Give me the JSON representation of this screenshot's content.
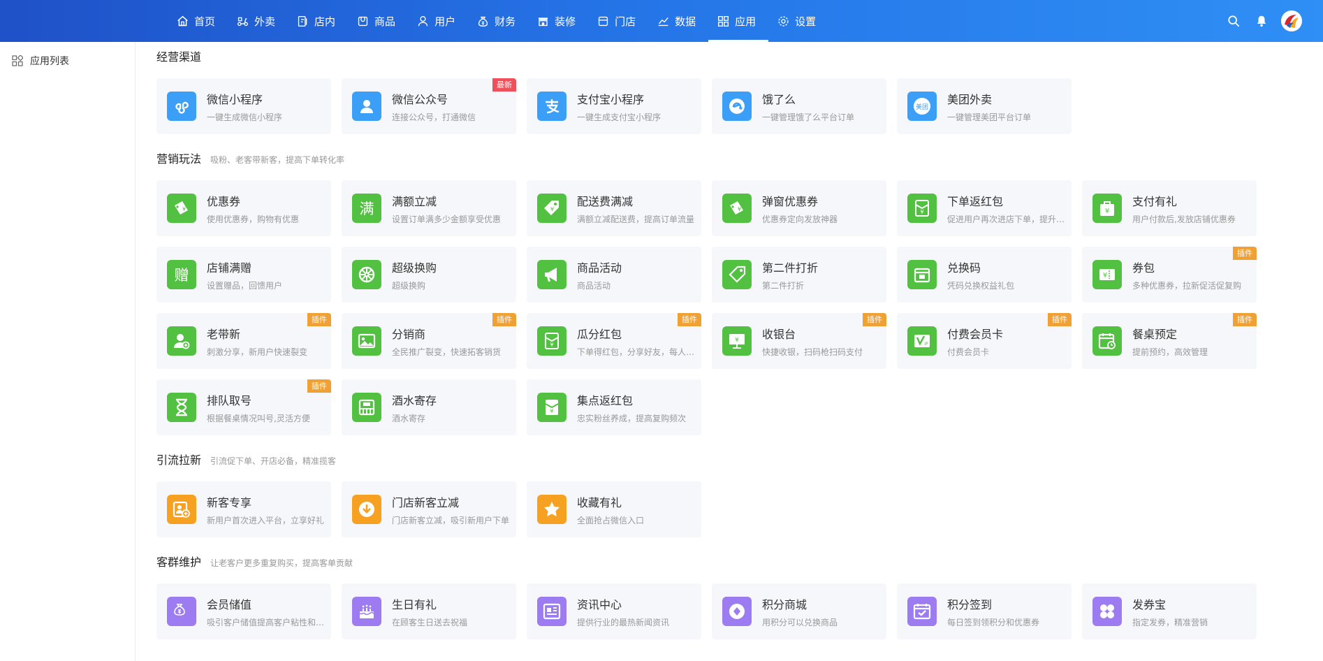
{
  "nav": {
    "items": [
      {
        "label": "首页",
        "icon": "home-icon"
      },
      {
        "label": "外卖",
        "icon": "scooter-icon"
      },
      {
        "label": "店内",
        "icon": "dine-in-icon"
      },
      {
        "label": "商品",
        "icon": "goods-icon"
      },
      {
        "label": "用户",
        "icon": "user-icon"
      },
      {
        "label": "财务",
        "icon": "money-bag-icon"
      },
      {
        "label": "装修",
        "icon": "shop-decor-icon"
      },
      {
        "label": "门店",
        "icon": "store-icon"
      },
      {
        "label": "数据",
        "icon": "chart-icon"
      },
      {
        "label": "应用",
        "icon": "apps-icon",
        "active": true
      },
      {
        "label": "设置",
        "icon": "gear-icon"
      }
    ],
    "active_index": 9
  },
  "sidebar": {
    "items": [
      {
        "label": "应用列表",
        "icon": "apps-icon"
      }
    ]
  },
  "colors": {
    "blue": "#3b9ff7",
    "green": "#52c041",
    "orange": "#f6a122",
    "purple": "#9c7cf0",
    "plugin_badge": "#f0a136",
    "new_badge": "#f0505a"
  },
  "sections": [
    {
      "title": "经营渠道",
      "subtitle": "",
      "cards": [
        {
          "name": "微信小程序",
          "desc": "一键生成微信小程序",
          "icon": "mini-program-icon",
          "color": "blue",
          "badge": ""
        },
        {
          "name": "微信公众号",
          "desc": "连接公众号，打通微信",
          "icon": "official-account-icon",
          "color": "blue",
          "badge": "最新"
        },
        {
          "name": "支付宝小程序",
          "desc": "一键生成支付宝小程序",
          "icon": "alipay-icon",
          "color": "blue",
          "badge": ""
        },
        {
          "name": "饿了么",
          "desc": "一键管理饿了么平台订单",
          "icon": "eleme-icon",
          "color": "blue",
          "badge": ""
        },
        {
          "name": "美团外卖",
          "desc": "一键管理美团平台订单",
          "icon": "meituan-icon",
          "color": "blue",
          "badge": ""
        }
      ]
    },
    {
      "title": "营销玩法",
      "subtitle": "吸粉、老客带新客，提高下单转化率",
      "cards": [
        {
          "name": "优惠券",
          "desc": "使用优惠券，购物有优惠",
          "icon": "coupon-icon",
          "color": "green",
          "badge": ""
        },
        {
          "name": "满额立减",
          "desc": "设置订单满多少金额享受优惠",
          "icon": "full-reduce-icon",
          "color": "green",
          "badge": ""
        },
        {
          "name": "配送费满减",
          "desc": "满额立减配送费，提高订单流量",
          "icon": "delivery-tag-icon",
          "color": "green",
          "badge": ""
        },
        {
          "name": "弹窗优惠券",
          "desc": "优惠券定向发放神器",
          "icon": "popup-coupon-icon",
          "color": "green",
          "badge": ""
        },
        {
          "name": "下单返红包",
          "desc": "促进用户再次进店下单，提升复购",
          "icon": "red-packet-icon",
          "color": "green",
          "badge": ""
        },
        {
          "name": "支付有礼",
          "desc": "用户付款后,发放店铺优惠券",
          "icon": "gift-bag-icon",
          "color": "green",
          "badge": ""
        },
        {
          "name": "店铺满赠",
          "desc": "设置赠品，回馈用户",
          "icon": "full-gift-icon",
          "color": "green",
          "badge": ""
        },
        {
          "name": "超级换购",
          "desc": "超级换购",
          "icon": "exchange-wheel-icon",
          "color": "green",
          "badge": ""
        },
        {
          "name": "商品活动",
          "desc": "商品活动",
          "icon": "megaphone-icon",
          "color": "green",
          "badge": ""
        },
        {
          "name": "第二件打折",
          "desc": "第二件打折",
          "icon": "discount-tag-icon",
          "color": "green",
          "badge": ""
        },
        {
          "name": "兑换码",
          "desc": "凭码兑换权益礼包",
          "icon": "redeem-code-icon",
          "color": "green",
          "badge": ""
        },
        {
          "name": "券包",
          "desc": "多种优惠券，拉新促活促复购",
          "icon": "coupon-pack-icon",
          "color": "green",
          "badge": "插件"
        },
        {
          "name": "老带新",
          "desc": "刺激分享，新用户快速裂变",
          "icon": "invite-user-icon",
          "color": "green",
          "badge": "插件"
        },
        {
          "name": "分销商",
          "desc": "全民推广裂变，快速拓客销货",
          "icon": "image-icon",
          "color": "green",
          "badge": "插件"
        },
        {
          "name": "瓜分红包",
          "desc": "下单得红包，分享好友，每人可得",
          "icon": "split-red-packet-icon",
          "color": "green",
          "badge": "插件"
        },
        {
          "name": "收银台",
          "desc": "快捷收银，扫码枪扫码支付",
          "icon": "cashier-icon",
          "color": "green",
          "badge": "插件"
        },
        {
          "name": "付费会员卡",
          "desc": "付费会员卡",
          "icon": "vip-card-icon",
          "color": "green",
          "badge": "插件"
        },
        {
          "name": "餐桌预定",
          "desc": "提前预约，高效管理",
          "icon": "table-reserve-icon",
          "color": "green",
          "badge": "插件"
        },
        {
          "name": "排队取号",
          "desc": "根据餐桌情况叫号,灵活方便",
          "icon": "hourglass-icon",
          "color": "green",
          "badge": "插件"
        },
        {
          "name": "酒水寄存",
          "desc": "酒水寄存",
          "icon": "storage-icon",
          "color": "green",
          "badge": ""
        },
        {
          "name": "集点返红包",
          "desc": "忠实粉丝养成，提高复购频次",
          "icon": "points-red-packet-icon",
          "color": "green",
          "badge": ""
        }
      ]
    },
    {
      "title": "引流拉新",
      "subtitle": "引流促下单、开店必备，精准揽客",
      "cards": [
        {
          "name": "新客专享",
          "desc": "新用户首次进入平台，立享好礼",
          "icon": "new-customer-icon",
          "color": "orange",
          "badge": ""
        },
        {
          "name": "门店新客立减",
          "desc": "门店新客立减，吸引新用户下单",
          "icon": "download-badge-icon",
          "color": "orange",
          "badge": ""
        },
        {
          "name": "收藏有礼",
          "desc": "全面抢占微信入口",
          "icon": "star-icon",
          "color": "orange",
          "badge": ""
        }
      ]
    },
    {
      "title": "客群维护",
      "subtitle": "让老客户更多重复购买，提高客单贡献",
      "cards": [
        {
          "name": "会员储值",
          "desc": "吸引客户储值提高客户粘性和复购",
          "icon": "money-bag-icon",
          "color": "purple",
          "badge": ""
        },
        {
          "name": "生日有礼",
          "desc": "在顾客生日送去祝福",
          "icon": "cake-icon",
          "color": "purple",
          "badge": ""
        },
        {
          "name": "资讯中心",
          "desc": "提供行业的最热新闻资讯",
          "icon": "news-icon",
          "color": "purple",
          "badge": ""
        },
        {
          "name": "积分商城",
          "desc": "用积分可以兑换商品",
          "icon": "points-mall-icon",
          "color": "purple",
          "badge": ""
        },
        {
          "name": "积分签到",
          "desc": "每日签到领积分和优惠券",
          "icon": "calendar-check-icon",
          "color": "purple",
          "badge": ""
        },
        {
          "name": "发券宝",
          "desc": "指定发券，精准营销",
          "icon": "grid-apps-icon",
          "color": "purple",
          "badge": ""
        }
      ]
    }
  ]
}
